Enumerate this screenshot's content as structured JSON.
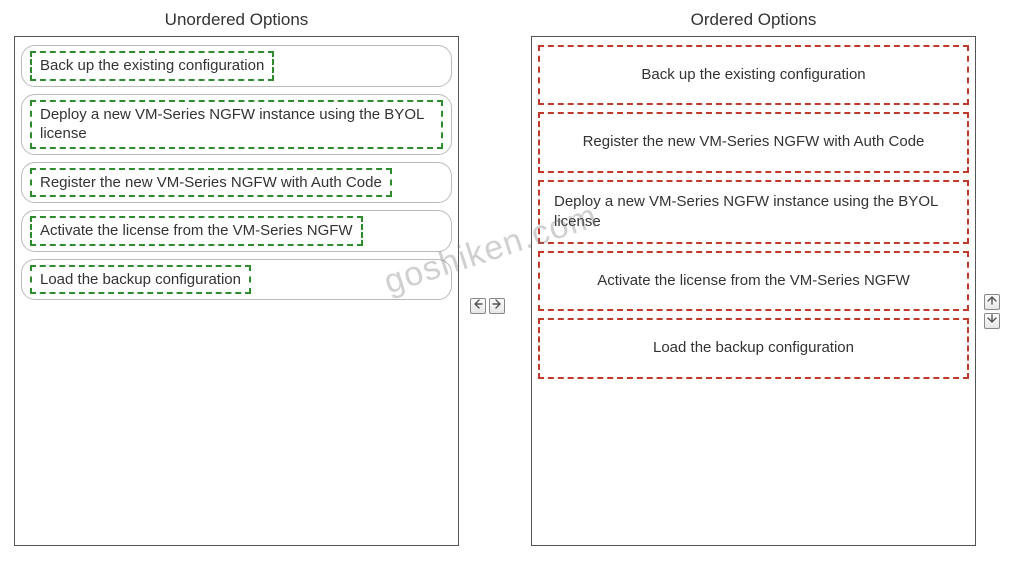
{
  "headings": {
    "unordered": "Unordered Options",
    "ordered": "Ordered Options"
  },
  "unordered_items": [
    "Back up the existing configuration",
    "Deploy a new VM-Series NGFW instance using the BYOL license",
    "Register the new VM-Series NGFW with Auth Code",
    "Activate the license from the VM-Series NGFW",
    "Load the backup configuration"
  ],
  "ordered_items": [
    "Back up the existing configuration",
    "Register the new VM-Series NGFW with Auth Code",
    "Deploy a new VM-Series NGFW instance using the BYOL license",
    "Activate the license from the VM-Series NGFW",
    "Load the backup configuration"
  ],
  "watermark": "goshiken.com"
}
